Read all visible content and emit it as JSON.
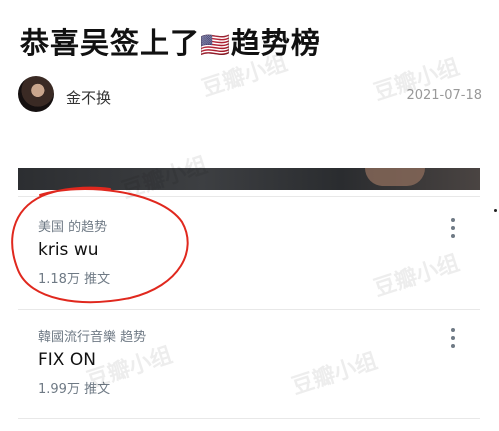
{
  "post": {
    "title": "恭喜吴签上了",
    "title_flag": "🇺🇸",
    "title_suffix": "趋势榜",
    "author": "金不换",
    "date": "2021-07-18"
  },
  "trends": [
    {
      "context": "美国 的趋势",
      "name": "kris wu",
      "count": "1.18万 推文",
      "circled": true
    },
    {
      "context": "韓國流行音樂 趋势",
      "name": "FIX ON",
      "count": "1.99万 推文",
      "circled": false
    }
  ],
  "watermark": {
    "text": "豆瓣小组"
  },
  "colors": {
    "annotation_red": "#e0281e",
    "secondary_text": "#6f7a85",
    "divider": "#e8e8e8"
  }
}
